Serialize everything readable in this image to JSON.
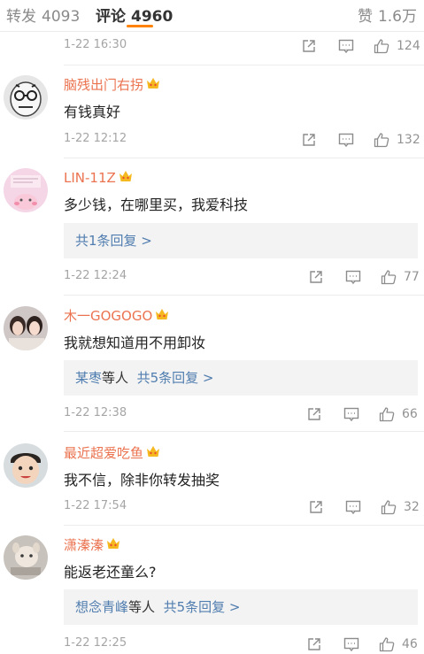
{
  "tabs": {
    "repost": {
      "label": "转发",
      "count": "4093"
    },
    "comment": {
      "label": "评论",
      "count": "4960"
    },
    "like": {
      "label": "赞",
      "count": "1.6万"
    }
  },
  "comments": [
    {
      "time": "1-22 16:30",
      "likes": "124"
    },
    {
      "user": "脑残出门右拐",
      "text": "有钱真好",
      "time": "1-22 12:12",
      "likes": "132"
    },
    {
      "user": "LIN-11Z",
      "text": "多少钱，在哪里买，我爱科技",
      "reply_summary": "共1条回复 >",
      "time": "1-22 12:24",
      "likes": "77"
    },
    {
      "user": "木一GOGOGO",
      "text": "我就想知道用不用卸妆",
      "reply_names": "某枣",
      "reply_mid": "等人",
      "reply_summary": "共5条回复 >",
      "time": "1-22 12:38",
      "likes": "66"
    },
    {
      "user": "最近超爱吃鱼",
      "text": "我不信，除非你转发抽奖",
      "time": "1-22 17:54",
      "likes": "32"
    },
    {
      "user": "潇溱溱",
      "text": "能返老还童么?",
      "reply_names": "想念青峰",
      "reply_mid": "等人",
      "reply_summary": "共5条回复 >",
      "time": "1-22 12:25",
      "likes": "46"
    }
  ],
  "icons": {
    "share": "share-icon",
    "comment": "comment-icon",
    "like": "thumbs-up-icon",
    "crown": "crown-badge-icon"
  },
  "colors": {
    "accent": "#ff8200",
    "username": "#eb7350",
    "link": "#507daf"
  }
}
